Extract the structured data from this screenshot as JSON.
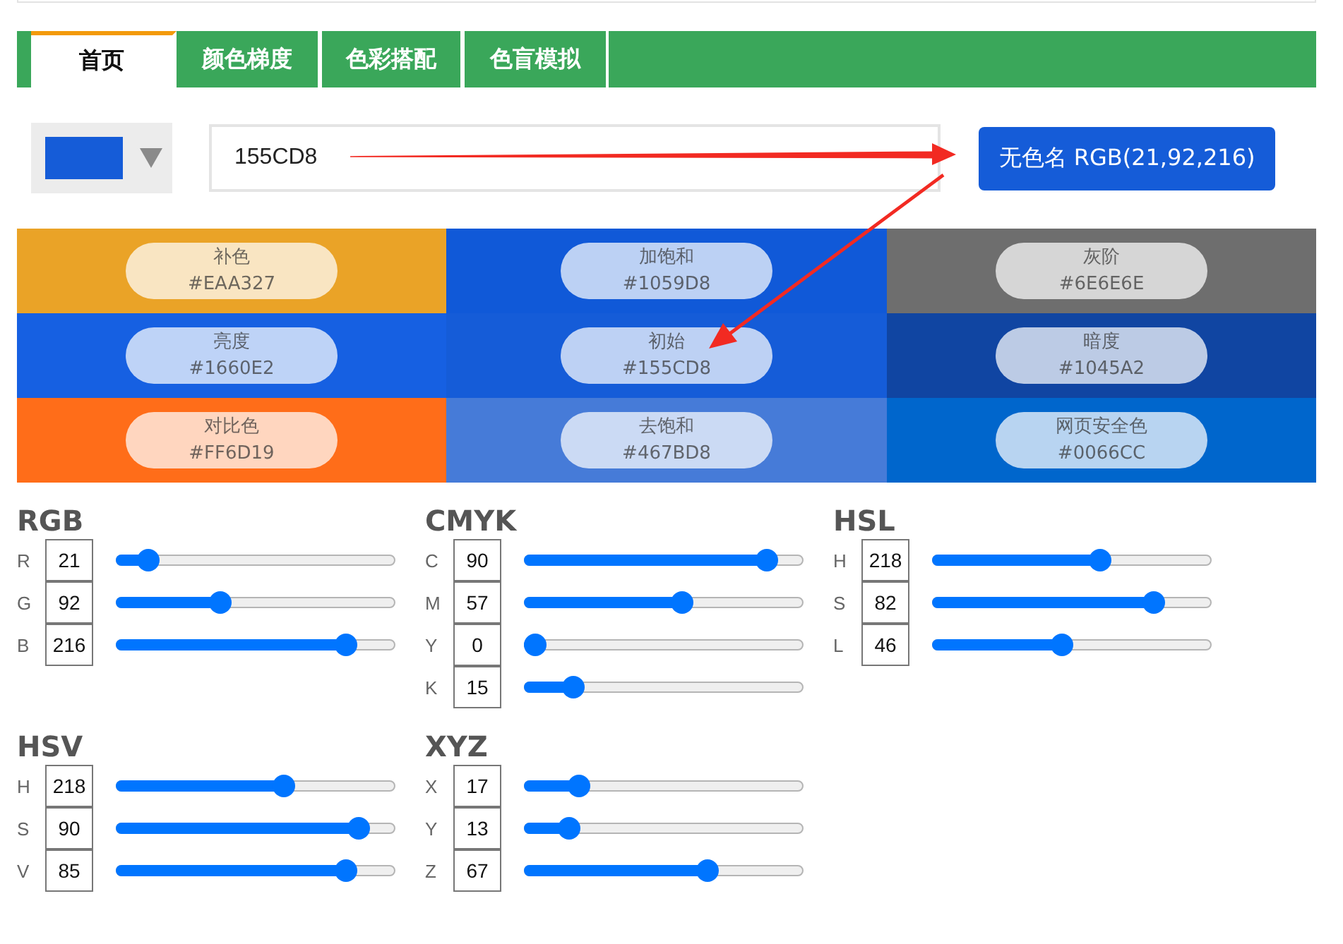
{
  "tabs": [
    {
      "label": "首页",
      "selected": true
    },
    {
      "label": "颜色梯度",
      "selected": false
    },
    {
      "label": "色彩搭配",
      "selected": false
    },
    {
      "label": "色盲模拟",
      "selected": false
    }
  ],
  "picker": {
    "color": "#155cd8"
  },
  "hex_input": {
    "value": "155CD8"
  },
  "name_button": {
    "label": "无色名 RGB(21,92,216)"
  },
  "swatches": [
    {
      "name": "补色",
      "hex": "#EAA327",
      "color": "#eaa327"
    },
    {
      "name": "加饱和",
      "hex": "#1059D8",
      "color": "#1059d8"
    },
    {
      "name": "灰阶",
      "hex": "#6E6E6E",
      "color": "#6e6e6e"
    },
    {
      "name": "亮度",
      "hex": "#1660E2",
      "color": "#1660e2"
    },
    {
      "name": "初始",
      "hex": "#155CD8",
      "color": "#155cd8"
    },
    {
      "name": "暗度",
      "hex": "#1045A2",
      "color": "#1045a2"
    },
    {
      "name": "对比色",
      "hex": "#FF6D19",
      "color": "#ff6d19"
    },
    {
      "name": "去饱和",
      "hex": "#467BD8",
      "color": "#467bd8"
    },
    {
      "name": "网页安全色",
      "hex": "#0066CC",
      "color": "#0066cc"
    }
  ],
  "sections": [
    {
      "title": "RGB",
      "channels": [
        {
          "label": "R",
          "value": "21",
          "level": 0.08
        },
        {
          "label": "G",
          "value": "92",
          "level": 0.36
        },
        {
          "label": "B",
          "value": "216",
          "level": 0.85
        }
      ]
    },
    {
      "title": "CMYK",
      "channels": [
        {
          "label": "C",
          "value": "90",
          "level": 0.9
        },
        {
          "label": "M",
          "value": "57",
          "level": 0.57
        },
        {
          "label": "Y",
          "value": "0",
          "level": 0
        },
        {
          "label": "K",
          "value": "15",
          "level": 0.15
        }
      ]
    },
    {
      "title": "HSL",
      "channels": [
        {
          "label": "H",
          "value": "218",
          "level": 0.61
        },
        {
          "label": "S",
          "value": "82",
          "level": 0.82
        },
        {
          "label": "L",
          "value": "46",
          "level": 0.46
        }
      ]
    },
    {
      "title": "HSV",
      "channels": [
        {
          "label": "H",
          "value": "218",
          "level": 0.61
        },
        {
          "label": "S",
          "value": "90",
          "level": 0.9
        },
        {
          "label": "V",
          "value": "85",
          "level": 0.85
        }
      ]
    },
    {
      "title": "XYZ",
      "channels": [
        {
          "label": "X",
          "value": "17",
          "level": 0.17
        },
        {
          "label": "Y",
          "value": "13",
          "level": 0.13
        },
        {
          "label": "Z",
          "value": "67",
          "level": 0.67
        }
      ]
    }
  ]
}
